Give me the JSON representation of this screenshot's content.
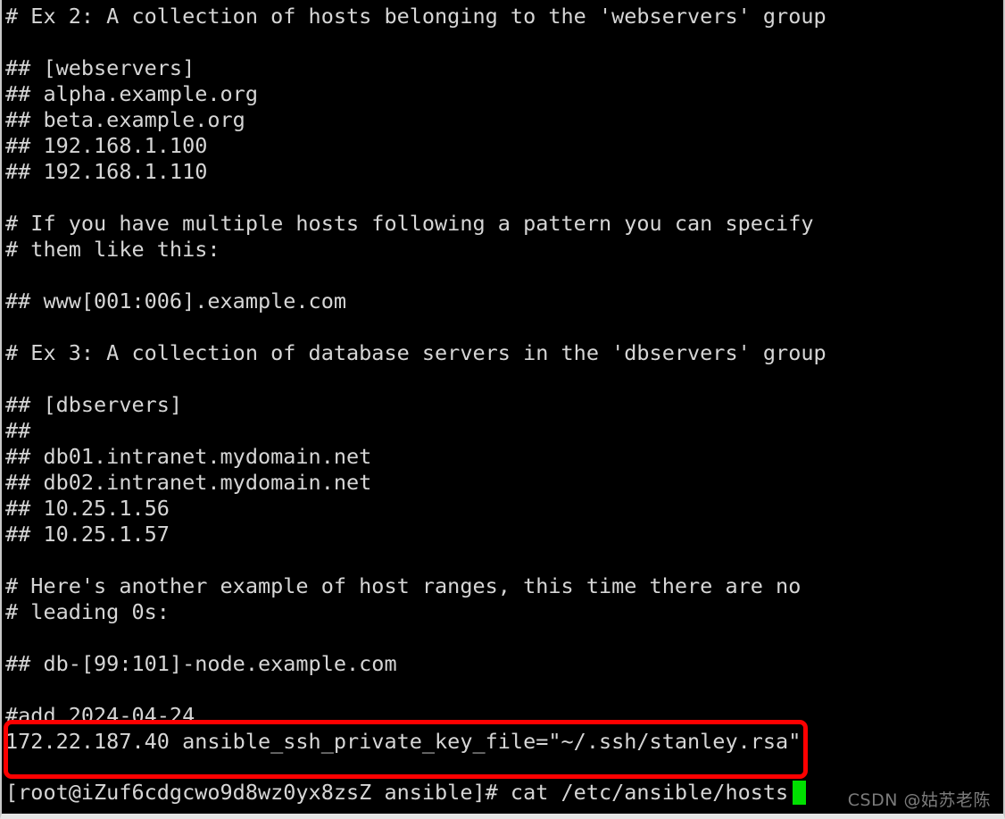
{
  "terminal": {
    "background_color": "#000000",
    "foreground_color": "#d6d6d6",
    "highlight_color": "#fe0000",
    "cursor_color": "#00e000",
    "lines": [
      "# Ex 2: A collection of hosts belonging to the 'webservers' group",
      "",
      "## [webservers]",
      "## alpha.example.org",
      "## beta.example.org",
      "## 192.168.1.100",
      "## 192.168.1.110",
      "",
      "# If you have multiple hosts following a pattern you can specify",
      "# them like this:",
      "",
      "## www[001:006].example.com",
      "",
      "# Ex 3: A collection of database servers in the 'dbservers' group",
      "",
      "## [dbservers]",
      "##",
      "## db01.intranet.mydomain.net",
      "## db02.intranet.mydomain.net",
      "## 10.25.1.56",
      "## 10.25.1.57",
      "",
      "# Here's another example of host ranges, this time there are no",
      "# leading 0s:",
      "",
      "## db-[99:101]-node.example.com",
      "",
      "#add 2024-04-24",
      "172.22.187.40 ansible_ssh_private_key_file=\"~/.ssh/stanley.rsa\""
    ]
  },
  "prompt": {
    "text": "[root@iZuf6cdgcwo9d8wz0yx8zsZ ansible]# cat /etc/ansible/hosts",
    "user": "root",
    "host": "iZuf6cdgcwo9d8wz0yx8zsZ",
    "cwd": "ansible",
    "symbol": "#",
    "command": "cat /etc/ansible/hosts"
  },
  "watermark": {
    "text": "CSDN @姑苏老陈"
  }
}
